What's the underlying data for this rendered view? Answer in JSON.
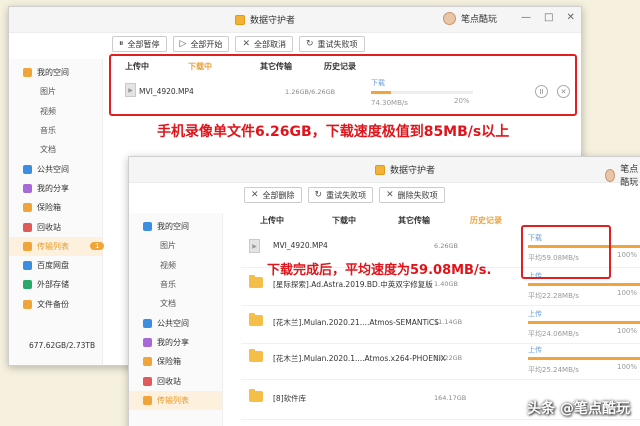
{
  "window1": {
    "title": "数据守护者",
    "user": "笔点酷玩",
    "controls": {
      "minimize": "—",
      "maximize": "□",
      "close": "✕"
    },
    "toolbar": [
      {
        "icon": "pause-icon",
        "glyph": "⏸",
        "label": "全部暂停"
      },
      {
        "icon": "play-icon",
        "glyph": "▷",
        "label": "全部开始"
      },
      {
        "icon": "close-icon",
        "glyph": "✕",
        "label": "全部取消"
      },
      {
        "icon": "retry-icon",
        "glyph": "↻",
        "label": "重试失败项"
      }
    ],
    "sidebar": [
      {
        "label": "我的空间",
        "icon": "cloud-icon",
        "color": "#f0a43a",
        "sub": false
      },
      {
        "label": "图片",
        "sub": true
      },
      {
        "label": "视频",
        "sub": true
      },
      {
        "label": "音乐",
        "sub": true
      },
      {
        "label": "文档",
        "sub": true
      },
      {
        "label": "公共空间",
        "icon": "share-icon",
        "color": "#3c8ee0",
        "sub": false
      },
      {
        "label": "我的分享",
        "icon": "my-share-icon",
        "color": "#a66ad8",
        "sub": false
      },
      {
        "label": "保险箱",
        "icon": "safe-icon",
        "color": "#f0a43a",
        "sub": false
      },
      {
        "label": "回收站",
        "icon": "trash-icon",
        "color": "#e05a5a",
        "sub": false
      },
      {
        "label": "传输列表",
        "icon": "transfer-icon",
        "color": "#f0a43a",
        "sub": false,
        "active": true,
        "badge": "1"
      },
      {
        "label": "百度网盘",
        "icon": "baidu-icon",
        "color": "#3c8ee0",
        "sub": false
      },
      {
        "label": "外部存储",
        "icon": "external-storage-icon",
        "color": "#2aa86a",
        "sub": false
      },
      {
        "label": "文件备份",
        "icon": "backup-icon",
        "color": "#f0a43a",
        "sub": false
      }
    ],
    "storage": "677.62GB/2.73TB",
    "tabs": [
      "上传中",
      "下载中",
      "其它传输",
      "历史记录"
    ],
    "active_tab": 1,
    "row": {
      "name": "MVI_4920.MP4",
      "size": "1.26GB/6.26GB",
      "status": "下载",
      "speed": "74.30MB/s",
      "percent": "20%",
      "progress": 0.2,
      "pause_glyph": "II",
      "cancel_glyph": "✕"
    },
    "annotation": "手机录像单文件6.26GB，下载速度极值到85MB/s以上"
  },
  "window2": {
    "title": "数据守护者",
    "user": "笔点酷玩",
    "toolbar": [
      {
        "icon": "delete-icon",
        "glyph": "✕",
        "label": "全部删除"
      },
      {
        "icon": "retry-icon",
        "glyph": "↻",
        "label": "重试失败项"
      },
      {
        "icon": "delete-failed-icon",
        "glyph": "✕",
        "label": "删除失败项"
      }
    ],
    "sidebar": [
      {
        "label": "我的空间",
        "icon": "cloud-icon",
        "color": "#3c8ee0",
        "sub": false
      },
      {
        "label": "图片",
        "sub": true
      },
      {
        "label": "视频",
        "sub": true
      },
      {
        "label": "音乐",
        "sub": true
      },
      {
        "label": "文档",
        "sub": true
      },
      {
        "label": "公共空间",
        "icon": "share-icon",
        "color": "#3c8ee0",
        "sub": false
      },
      {
        "label": "我的分享",
        "icon": "my-share-icon",
        "color": "#a66ad8",
        "sub": false
      },
      {
        "label": "保险箱",
        "icon": "safe-icon",
        "color": "#f0a43a",
        "sub": false
      },
      {
        "label": "回收站",
        "icon": "trash-icon",
        "color": "#e05a5a",
        "sub": false
      },
      {
        "label": "传输列表",
        "icon": "transfer-icon",
        "color": "#f0a43a",
        "sub": false,
        "active": true
      }
    ],
    "tabs": [
      "上传中",
      "下载中",
      "其它传输",
      "历史记录"
    ],
    "active_tab": 3,
    "rows": [
      {
        "type": "file",
        "name": "MVI_4920.MP4",
        "size": "6.26GB",
        "status": "下载",
        "speed": "平均59.08MB/s",
        "percent": "100%"
      },
      {
        "type": "folder",
        "name": "[星际探索].Ad.Astra.2019.BD.中英双字修复版",
        "size": "1.40GB",
        "status": "上传",
        "speed": "平均22.28MB/s",
        "percent": "100%"
      },
      {
        "type": "folder",
        "name": "[花木兰].Mulan.2020.21....Atmos-SEMANTiCS",
        "size": "11.14GB",
        "status": "上传",
        "speed": "平均24.06MB/s",
        "percent": "100%"
      },
      {
        "type": "folder",
        "name": "[花木兰].Mulan.2020.1....Atmos.x264-PHOENiX",
        "size": "12.22GB",
        "status": "上传",
        "speed": "平均25.24MB/s",
        "percent": "100%"
      },
      {
        "type": "folder",
        "name": "[8]软件库",
        "size": "164.17GB",
        "status": "",
        "speed": "",
        "percent": ""
      }
    ],
    "annotation": "下载完成后，平均速度为59.08MB/s."
  },
  "watermark": "头条 @笔点酷玩"
}
